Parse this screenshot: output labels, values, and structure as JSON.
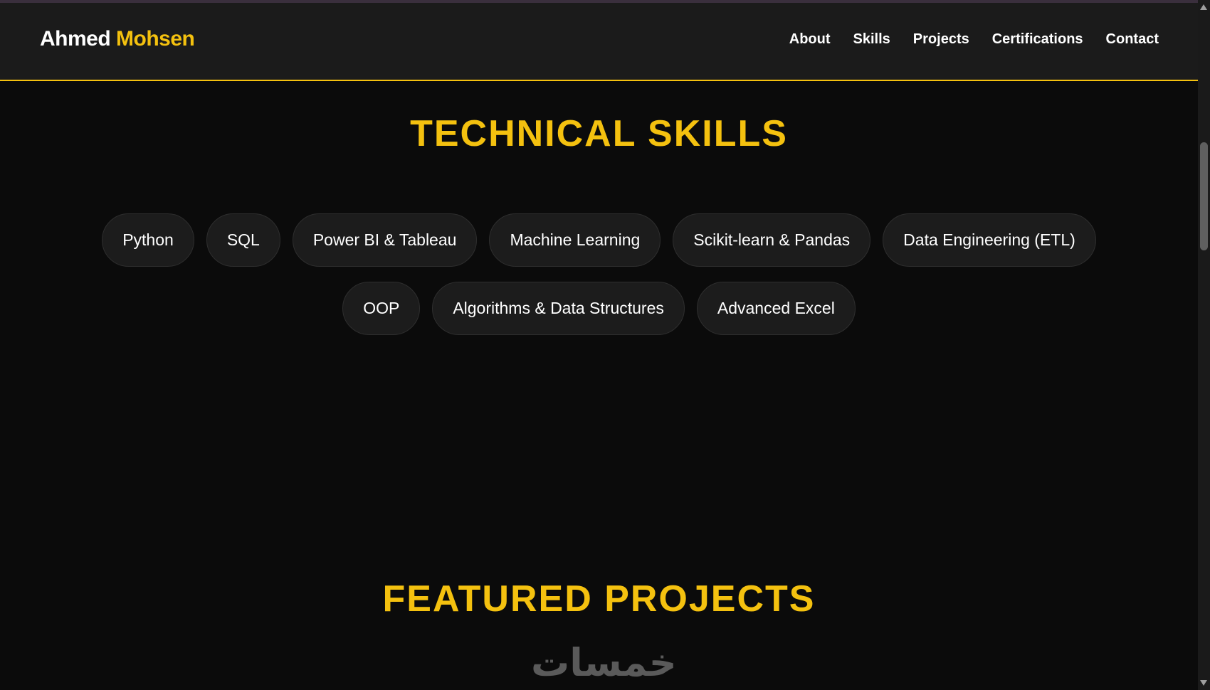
{
  "brand": {
    "first": "Ahmed",
    "last": "Mohsen"
  },
  "nav": [
    "About",
    "Skills",
    "Projects",
    "Certifications",
    "Contact"
  ],
  "skills_title": "TECHNICAL SKILLS",
  "skills_rows": [
    [
      "Python",
      "SQL",
      "Power BI & Tableau",
      "Machine Learning",
      "Scikit-learn & Pandas",
      "Data Engineering (ETL)"
    ],
    [
      "OOP",
      "Algorithms & Data Structures",
      "Advanced Excel"
    ]
  ],
  "projects_title": "FEATURED PROJECTS",
  "watermark": "خمسات",
  "colors": {
    "accent": "#f4c10f",
    "background": "#0b0b0b",
    "navbar": "#1b1b1b",
    "pill": "#1c1c1c"
  }
}
